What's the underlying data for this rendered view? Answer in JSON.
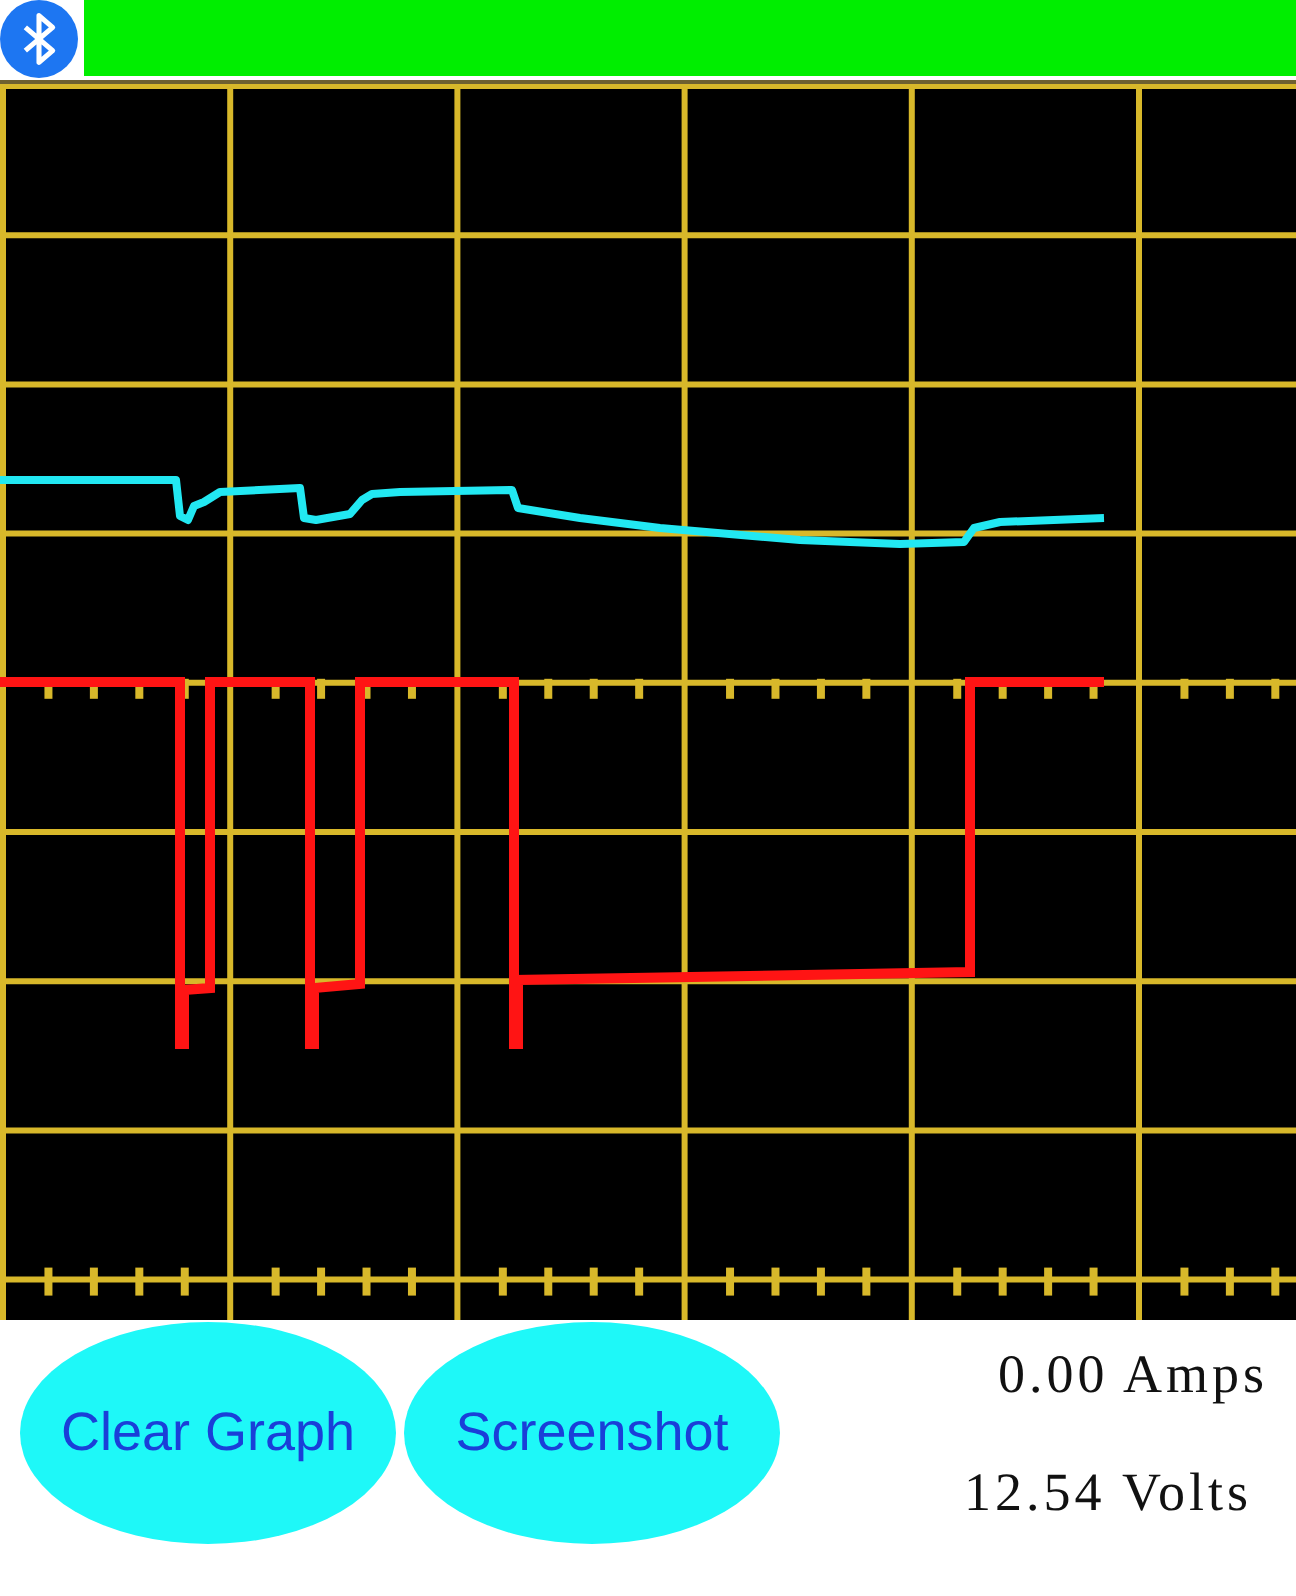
{
  "connection": {
    "connected": true
  },
  "buttons": [
    {
      "label": "Clear Graph"
    },
    {
      "label": "Screenshot"
    }
  ],
  "readings": [
    {
      "text": "0.00 Amps"
    },
    {
      "text": "12.54 Volts"
    }
  ]
}
